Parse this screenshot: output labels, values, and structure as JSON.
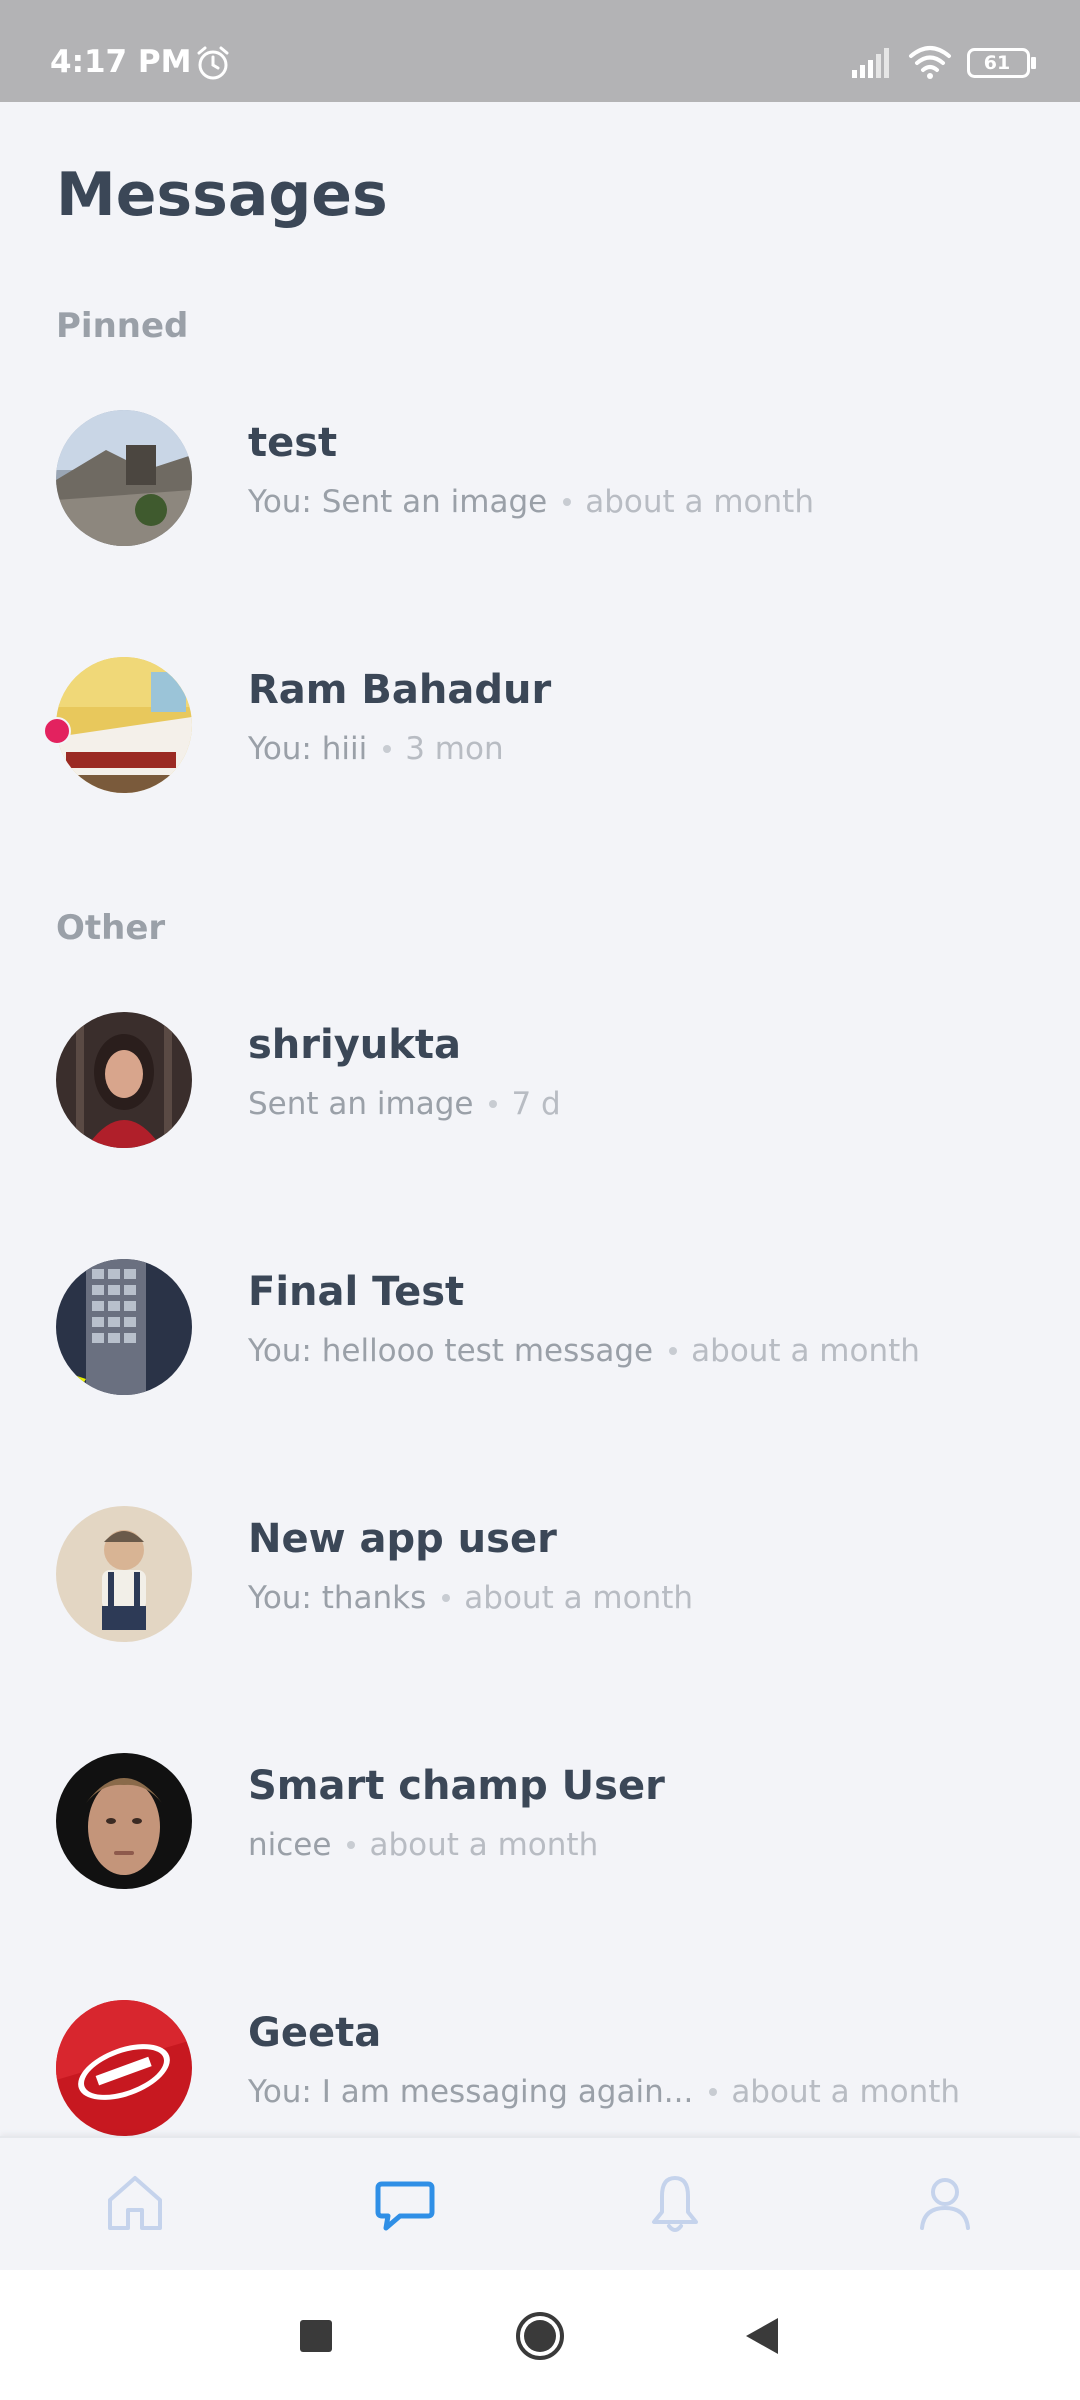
{
  "status_bar": {
    "time": "4:17 PM",
    "battery": "61"
  },
  "page": {
    "title": "Messages"
  },
  "sections": {
    "pinned": "Pinned",
    "other": "Other"
  },
  "conversations": [
    {
      "name": "test",
      "preview": "You: Sent an image",
      "time": "about a month",
      "unread": false,
      "avatar": "photo-balcony"
    },
    {
      "name": "Ram Bahadur",
      "preview": "You: hiii",
      "time": "3 mon",
      "unread": true,
      "avatar": "photo-hotel-room"
    },
    {
      "name": "shriyukta",
      "preview": "Sent an image",
      "time": "7 d",
      "unread": false,
      "avatar": "photo-portrait-woman"
    },
    {
      "name": "Final Test",
      "preview": "You: hellooo test message",
      "time": "about a month",
      "unread": false,
      "avatar": "photo-keyboard"
    },
    {
      "name": "New app user",
      "preview": "You: thanks",
      "time": "about a month",
      "unread": false,
      "avatar": "photo-child"
    },
    {
      "name": "Smart champ User",
      "preview": "nicee",
      "time": "about a month",
      "unread": false,
      "avatar": "photo-portrait-man"
    },
    {
      "name": "Geeta",
      "preview": "You: I am messaging again...",
      "time": "about a month",
      "unread": false,
      "avatar": "photo-kitkat"
    }
  ],
  "bottom_nav": {
    "items": [
      {
        "icon": "home-icon",
        "active": false
      },
      {
        "icon": "chat-icon",
        "active": true
      },
      {
        "icon": "bell-icon",
        "active": false
      },
      {
        "icon": "profile-icon",
        "active": false
      }
    ],
    "active_color": "#2f8fe6",
    "inactive_color": "#c5d3ec"
  }
}
